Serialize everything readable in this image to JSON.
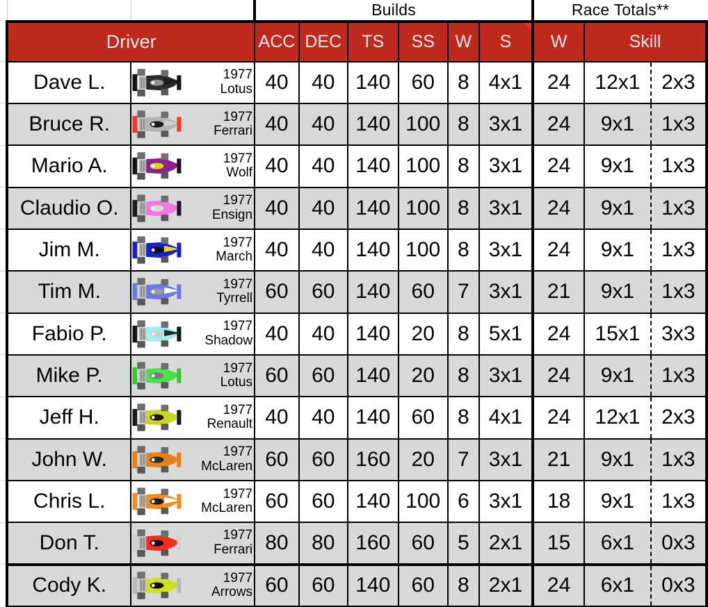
{
  "title_band": {
    "builds_label": "Builds",
    "race_totals_label": "Race Totals**"
  },
  "headers": {
    "driver": "Driver",
    "builds": [
      "ACC",
      "DEC",
      "TS",
      "SS",
      "W",
      "S"
    ],
    "race_totals_w": "W",
    "race_totals_skill": "Skill"
  },
  "colors": {
    "header_red": "#bf2a1e",
    "comment_flag_red": "#f0301c",
    "alt_row_gray": "#d9d9d9",
    "grid_black": "#000000"
  },
  "icons": {
    "comment_flag": "comment-flag-icon"
  },
  "rows": [
    {
      "driver": "Dave L.",
      "year": "1977",
      "team": "Lotus",
      "car_body": "#2b2b2b",
      "car_wing": "#141414",
      "car_nose": "#1c1c1c",
      "car_cockpit": "#8f8f8f",
      "acc": "40",
      "dec": "40",
      "ts": "140",
      "ss": "60",
      "w": "8",
      "s": "4x1",
      "total_w": "24",
      "skill_a": "12x1",
      "skill_b": "2x3",
      "shaded": false
    },
    {
      "driver": "Bruce R.",
      "year": "1977",
      "team": "Ferrari",
      "car_body": "#b5b5b5",
      "car_wing": "#f03b28",
      "car_nose": "#cfcfcf",
      "car_cockpit": "#1a1a1a",
      "acc": "40",
      "dec": "40",
      "ts": "140",
      "ss": "100",
      "w": "8",
      "s": "3x1",
      "total_w": "24",
      "skill_a": "9x1",
      "skill_b": "1x3",
      "shaded": true
    },
    {
      "driver": "Mario A.",
      "year": "1977",
      "team": "Wolf",
      "car_body": "#8b2191",
      "car_wing": "#161616",
      "car_nose": "#8b2191",
      "car_cockpit": "#e8d313",
      "acc": "40",
      "dec": "40",
      "ts": "140",
      "ss": "100",
      "w": "8",
      "s": "3x1",
      "total_w": "24",
      "skill_a": "9x1",
      "skill_b": "1x3",
      "shaded": false
    },
    {
      "driver": "Claudio O.",
      "year": "1977",
      "team": "Ensign",
      "car_body": "#f07ae0",
      "car_wing": "#1a1a1a",
      "car_nose": "#f07ae0",
      "car_cockpit": "#d8d8d8",
      "acc": "40",
      "dec": "40",
      "ts": "140",
      "ss": "100",
      "w": "8",
      "s": "3x1",
      "total_w": "24",
      "skill_a": "9x1",
      "skill_b": "1x3",
      "shaded": true
    },
    {
      "driver": "Jim M.",
      "year": "1977",
      "team": "March",
      "car_body": "#1423c8",
      "car_wing": "#1423c8",
      "car_nose": "#f2d21a",
      "car_cockpit": "#101010",
      "acc": "40",
      "dec": "40",
      "ts": "140",
      "ss": "100",
      "w": "8",
      "s": "3x1",
      "total_w": "24",
      "skill_a": "9x1",
      "skill_b": "1x3",
      "shaded": false
    },
    {
      "driver": "Tim M.",
      "year": "1977",
      "team": "Tyrrell",
      "car_body": "#6d78e0",
      "car_wing": "#6d78e0",
      "car_nose": "#ffffff",
      "car_cockpit": "#9a9a9a",
      "acc": "60",
      "dec": "60",
      "ts": "140",
      "ss": "60",
      "w": "7",
      "s": "3x1",
      "total_w": "21",
      "skill_a": "9x1",
      "skill_b": "1x3",
      "shaded": true
    },
    {
      "driver": "Fabio P.",
      "year": "1977",
      "team": "Shadow",
      "car_body": "#9ef0ec",
      "car_wing": "#141414",
      "car_nose": "#262626",
      "car_cockpit": "#cfcfcf",
      "acc": "40",
      "dec": "40",
      "ts": "140",
      "ss": "20",
      "w": "8",
      "s": "5x1",
      "total_w": "24",
      "skill_a": "15x1",
      "skill_b": "3x3",
      "shaded": false
    },
    {
      "driver": "Mike P.",
      "year": "1977",
      "team": "Lotus",
      "car_body": "#4ce04c",
      "car_wing": "#3ac63a",
      "car_nose": "#4ce04c",
      "car_cockpit": "#7a7a7a",
      "acc": "60",
      "dec": "60",
      "ts": "140",
      "ss": "20",
      "w": "8",
      "s": "3x1",
      "total_w": "24",
      "skill_a": "9x1",
      "skill_b": "1x3",
      "shaded": true
    },
    {
      "driver": "Jeff H.",
      "year": "1977",
      "team": "Renault",
      "car_body": "#ccd422",
      "car_wing": "#1a1a1a",
      "car_nose": "#ccd422",
      "car_cockpit": "#171717",
      "acc": "40",
      "dec": "40",
      "ts": "140",
      "ss": "60",
      "w": "8",
      "s": "4x1",
      "total_w": "24",
      "skill_a": "12x1",
      "skill_b": "2x3",
      "shaded": false
    },
    {
      "driver": "John W.",
      "year": "1977",
      "team": "McLaren",
      "car_body": "#e8811c",
      "car_wing": "#e8811c",
      "car_nose": "#e8811c",
      "car_cockpit": "#2e2a22",
      "acc": "60",
      "dec": "60",
      "ts": "160",
      "ss": "20",
      "w": "7",
      "s": "3x1",
      "total_w": "21",
      "skill_a": "9x1",
      "skill_b": "1x3",
      "shaded": true
    },
    {
      "driver": "Chris L.",
      "year": "1977",
      "team": "McLaren",
      "car_body": "#ef8c24",
      "car_wing": "#ef8c24",
      "car_nose": "#ffffff",
      "car_cockpit": "#1f1f1f",
      "acc": "60",
      "dec": "60",
      "ts": "140",
      "ss": "100",
      "w": "6",
      "s": "3x1",
      "total_w": "18",
      "skill_a": "9x1",
      "skill_b": "1x3",
      "shaded": false
    },
    {
      "driver": "Don T.",
      "year": "1977",
      "team": "Ferrari",
      "car_body": "#f22d22",
      "car_wing": "#cfcfcf",
      "car_nose": "#f22d22",
      "car_cockpit": "#121212",
      "acc": "80",
      "dec": "80",
      "ts": "160",
      "ss": "60",
      "w": "5",
      "s": "2x1",
      "total_w": "15",
      "skill_a": "6x1",
      "skill_b": "0x3",
      "shaded": true
    },
    {
      "driver": "Cody K.",
      "year": "1977",
      "team": "Arrows",
      "car_body": "#cde022",
      "car_wing": "#b9b9b9",
      "car_nose": "#cde022",
      "car_cockpit": "#101010",
      "acc": "60",
      "dec": "60",
      "ts": "140",
      "ss": "60",
      "w": "8",
      "s": "2x1",
      "total_w": "24",
      "skill_a": "6x1",
      "skill_b": "0x3",
      "shaded": true
    }
  ]
}
